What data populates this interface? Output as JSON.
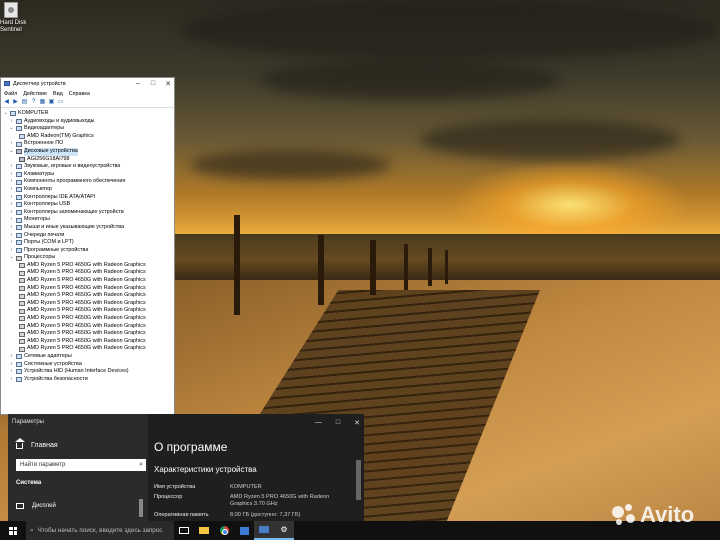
{
  "desktop": {
    "icon_label_line1": "Hard Disk",
    "icon_label_line2": "Sentinel"
  },
  "device_manager": {
    "title": "Диспетчер устройств",
    "menu": [
      "Файл",
      "Действие",
      "Вид",
      "Справка"
    ],
    "root": "KOMPUTER",
    "categories": [
      "Аудиовходы и аудиовыходы",
      "Видеоадаптеры",
      "AMD Radeon(TM) Graphics",
      "Встроенное ПО",
      "Дисковые устройства",
      "AGI256G18AI798",
      "Звуковые, игровые и видеоустройства",
      "Клавиатуры",
      "Компоненты программного обеспечения",
      "Компьютер",
      "Контроллеры IDE ATA/ATAPI",
      "Контроллеры USB",
      "Контроллеры запоминающих устройств",
      "Мониторы",
      "Мыши и иные указывающие устройства",
      "Очереди печати",
      "Порты (COM и LPT)",
      "Программные устройства",
      "Процессоры"
    ],
    "cpu_name": "AMD Ryzen 5 PRO 4650G with Radeon Graphics",
    "after": [
      "Сетевые адаптеры",
      "Системные устройства",
      "Устройства HID (Human Interface Devices)",
      "Устройства безопасности"
    ]
  },
  "settings": {
    "window_title": "Параметры",
    "home_label": "Главная",
    "search_placeholder": "Найти параметр",
    "system_label": "Система",
    "display_label": "Дисплей",
    "page_title": "О программе",
    "section_title": "Характеристики устройства",
    "specs": [
      {
        "key": "Имя устройства",
        "value": "KOMPUTER"
      },
      {
        "key": "Процессор",
        "value": "AMD Ryzen 5 PRO 4650G with Radeon Graphics   3.70 GHz"
      },
      {
        "key": "Оперативная память",
        "value": "8,00 ГБ (доступно: 7,37 ГБ)"
      }
    ],
    "window_buttons": [
      "—",
      "□",
      "✕"
    ]
  },
  "taskbar": {
    "search_placeholder": "Чтобы начать поиск, введите здесь запрос"
  },
  "watermark": {
    "text": "Avito"
  }
}
